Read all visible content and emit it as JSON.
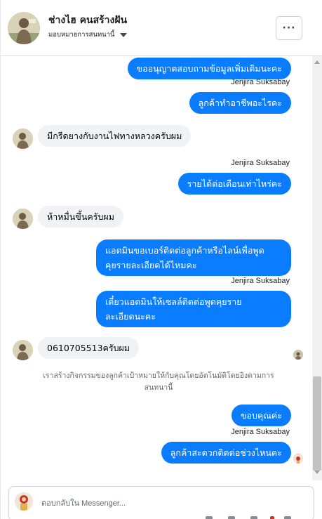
{
  "header": {
    "page_name": "ช่างไฮ คนสร้างฝัน",
    "assign_label": "มอบหมายการสนทนานี้",
    "more_label": "···"
  },
  "messages": [
    {
      "from": "page",
      "text": "ขออนุญาตสอบถามข้อมูลเพิ่มเติมนะคะ"
    },
    {
      "from": "page_sender",
      "text": "Jenjira Suksabay"
    },
    {
      "from": "page",
      "text": "ลูกค้าทำอาชีพอะไรคะ"
    },
    {
      "from": "customer",
      "text": "มีกรีดยางกับงานไฟทางหลวงครับผม"
    },
    {
      "from": "page_sender",
      "text": "Jenjira Suksabay"
    },
    {
      "from": "page",
      "text": "รายได้ต่อเดือนเท่าไหร่คะ"
    },
    {
      "from": "customer",
      "text": "ห้าหมื่นขึ้นครับผม"
    },
    {
      "from": "page",
      "text_line1": "แอดมินขอเบอร์ติดต่อลูกค้าหรือไลน์เพื่อพูด",
      "text_line2": "คุยรายละเอียดได้ไหมคะ"
    },
    {
      "from": "page_sender",
      "text": "Jenjira Suksabay"
    },
    {
      "from": "page",
      "text_line1": "เดี๋ยวแอดมินให้เซลล์ติดต่อพูดคุยราย",
      "text_line2": "ละเอียดนะคะ"
    },
    {
      "from": "customer",
      "text": "0610705513ครับผม"
    },
    {
      "from": "system",
      "text_line1": "เราสร้างกิจกรรมของลูกค้าเป้าหมายให้กับคุณโดยอัตโนมัติโดยอิงตามการ",
      "text_line2": "สนทนานี้"
    },
    {
      "from": "page",
      "text": "ขอบคุณค่ะ"
    },
    {
      "from": "page_sender",
      "text": "Jenjira Suksabay"
    },
    {
      "from": "page",
      "text": "ลูกค้าสะดวกติดต่อช่วงไหนคะ"
    }
  ],
  "composer": {
    "placeholder": "ตอบกลับใน Messenger..."
  },
  "colors": {
    "outgoing_bubble": "#0a7cff",
    "incoming_bubble": "#f0f2f5"
  }
}
